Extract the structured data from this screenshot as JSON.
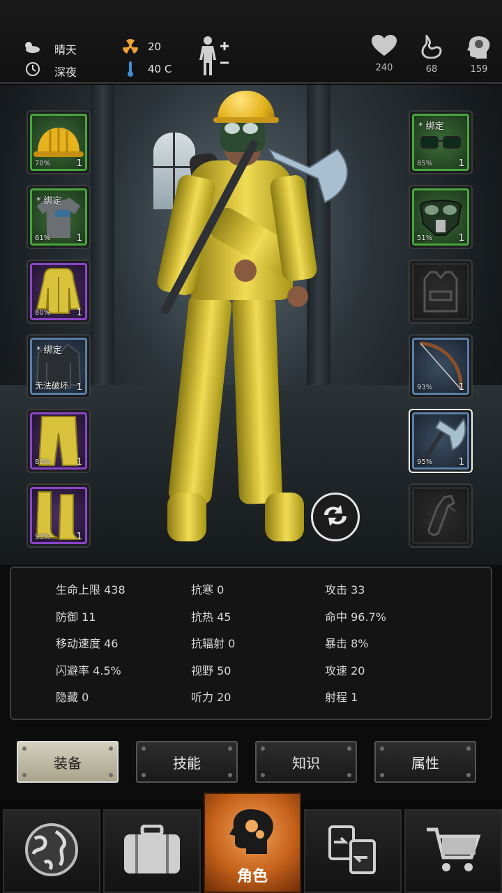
{
  "status": {
    "weather": {
      "icon": "cloud-sun-icon",
      "label": "晴天"
    },
    "time": {
      "icon": "clock-icon",
      "label": "深夜"
    },
    "radiation": {
      "icon": "radiation-icon",
      "value": "20"
    },
    "temperature": {
      "icon": "thermometer-icon",
      "value": "40 C"
    },
    "body_icon": "body-plus-minus-icon"
  },
  "vitals": [
    {
      "name": "health",
      "icon": "heart-icon",
      "value": "240"
    },
    {
      "name": "hunger",
      "icon": "stomach-icon",
      "value": "68"
    },
    {
      "name": "sanity",
      "icon": "head-brain-icon",
      "value": "159"
    }
  ],
  "left_slots": [
    {
      "name": "slot-helmet",
      "item": "hard-hat",
      "rarity": "green",
      "percent": "70%",
      "qty": "1",
      "tag": "",
      "note": ""
    },
    {
      "name": "slot-shirt",
      "item": "t-shirt",
      "rarity": "green",
      "percent": "61%",
      "qty": "1",
      "tag": "* 绑定",
      "note": ""
    },
    {
      "name": "slot-jacket",
      "item": "hazmat-jacket",
      "rarity": "purple",
      "percent": "80%",
      "qty": "1",
      "tag": "",
      "note": ""
    },
    {
      "name": "slot-backpack",
      "item": "leather-jacket",
      "rarity": "blue",
      "percent": "",
      "qty": "1",
      "tag": "* 绑定",
      "note": "无法破坏"
    },
    {
      "name": "slot-pants",
      "item": "hazmat-pants",
      "rarity": "purple",
      "percent": "80%",
      "qty": "1",
      "tag": "",
      "note": ""
    },
    {
      "name": "slot-boots",
      "item": "rubber-boots",
      "rarity": "purple",
      "percent": "93%",
      "qty": "1",
      "tag": "",
      "note": ""
    }
  ],
  "right_slots": [
    {
      "name": "slot-glasses",
      "item": "glasses",
      "rarity": "green",
      "percent": "85%",
      "qty": "1",
      "tag": "* 绑定",
      "note": ""
    },
    {
      "name": "slot-mask",
      "item": "gas-mask",
      "rarity": "green",
      "percent": "51%",
      "qty": "1",
      "tag": "",
      "note": ""
    },
    {
      "name": "slot-armor",
      "item": "vest-empty",
      "rarity": "empty",
      "percent": "",
      "qty": "",
      "tag": "",
      "note": ""
    },
    {
      "name": "slot-ranged",
      "item": "bow",
      "rarity": "blue",
      "percent": "93%",
      "qty": "1",
      "tag": "",
      "note": ""
    },
    {
      "name": "slot-melee",
      "item": "axe",
      "rarity": "blue",
      "percent": "95%",
      "qty": "1",
      "tag": "",
      "note": "",
      "selected": true
    },
    {
      "name": "slot-throwable",
      "item": "molotov-empty",
      "rarity": "empty",
      "percent": "",
      "qty": "",
      "tag": "",
      "note": ""
    }
  ],
  "stats": [
    [
      "生命上限 438",
      "抗寒 0",
      "攻击 33"
    ],
    [
      "防御 11",
      "抗热 45",
      "命中 96.7%"
    ],
    [
      "移动速度 46",
      "抗辐射 0",
      "暴击 8%"
    ],
    [
      "闪避率 4.5%",
      "视野 50",
      "攻速 20"
    ],
    [
      "隐藏 0",
      "听力 20",
      "射程 1"
    ]
  ],
  "tabs": [
    {
      "label": "装备",
      "active": true
    },
    {
      "label": "技能",
      "active": false
    },
    {
      "label": "知识",
      "active": false
    },
    {
      "label": "属性",
      "active": false
    }
  ],
  "nav": [
    {
      "name": "map",
      "icon": "globe-icon",
      "label": ""
    },
    {
      "name": "inventory",
      "icon": "suitcase-icon",
      "label": ""
    },
    {
      "name": "character",
      "icon": "head-gears-icon",
      "label": "角色",
      "active": true
    },
    {
      "name": "trade",
      "icon": "exchange-icon",
      "label": ""
    },
    {
      "name": "shop",
      "icon": "cart-icon",
      "label": ""
    }
  ],
  "colors": {
    "accent_orange": "#d9701f",
    "rarity_green": "#4aa53e",
    "rarity_purple": "#8c45c8",
    "rarity_blue": "#5b7fa6"
  }
}
